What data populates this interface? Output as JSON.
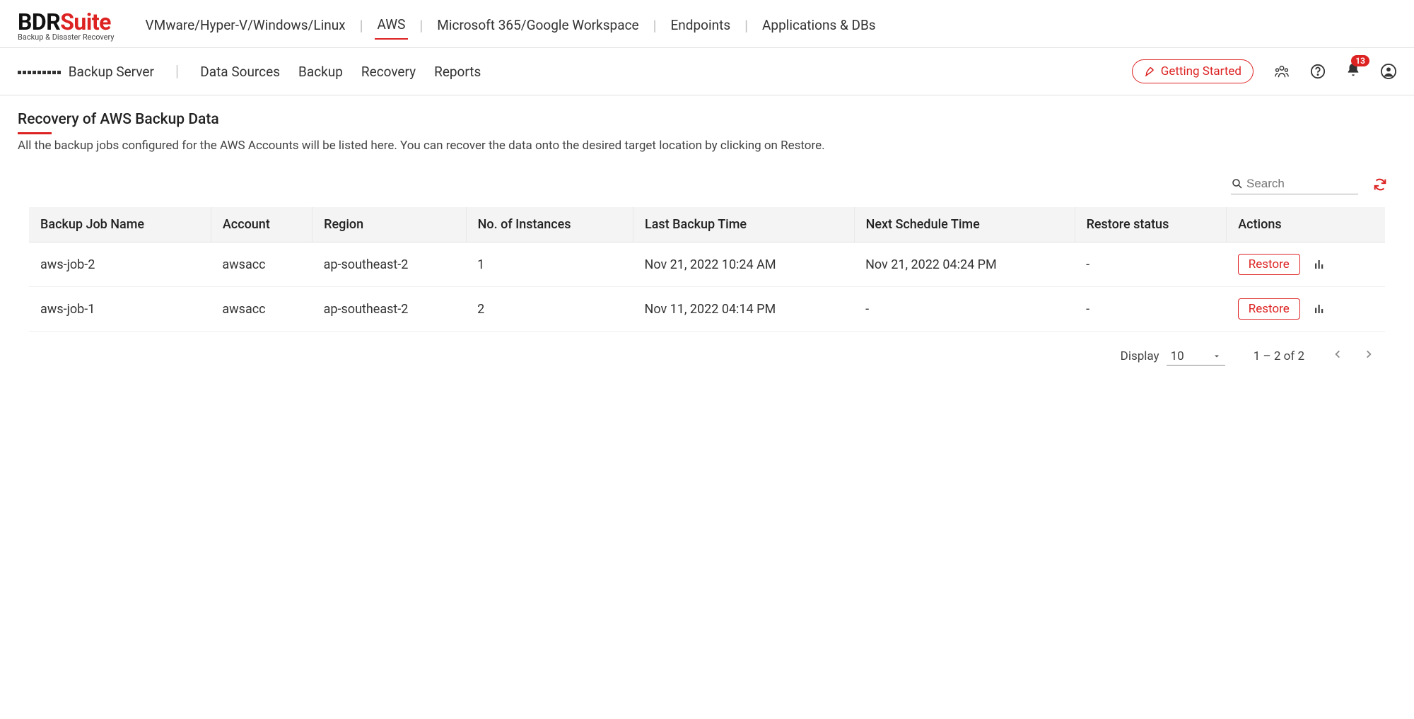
{
  "brand": {
    "main_dark": "BDR",
    "main_accent": "Suite",
    "sub": "Backup & Disaster Recovery"
  },
  "topnav": [
    {
      "label": "VMware/Hyper-V/Windows/Linux",
      "active": false
    },
    {
      "label": "AWS",
      "active": true
    },
    {
      "label": "Microsoft 365/Google Workspace",
      "active": false
    },
    {
      "label": "Endpoints",
      "active": false
    },
    {
      "label": "Applications & DBs",
      "active": false
    }
  ],
  "subnav": {
    "backup_server": "Backup Server",
    "items": [
      {
        "label": "Data Sources"
      },
      {
        "label": "Backup"
      },
      {
        "label": "Recovery"
      },
      {
        "label": "Reports"
      }
    ]
  },
  "buttons": {
    "getting_started": "Getting Started",
    "restore": "Restore"
  },
  "notifications": {
    "count": "13"
  },
  "page": {
    "title": "Recovery of AWS Backup Data",
    "description": "All the backup jobs configured for the AWS Accounts will be listed here. You can recover the data onto the desired target location by clicking on Restore."
  },
  "search": {
    "placeholder": "Search"
  },
  "table": {
    "headers": {
      "job_name": "Backup Job Name",
      "account": "Account",
      "region": "Region",
      "instances": "No. of Instances",
      "last_backup": "Last Backup Time",
      "next_schedule": "Next Schedule Time",
      "restore_status": "Restore status",
      "actions": "Actions"
    },
    "rows": [
      {
        "job_name": "aws-job-2",
        "account": "awsacc",
        "region": "ap-southeast-2",
        "instances": "1",
        "last_backup": "Nov 21, 2022 10:24 AM",
        "next_schedule": "Nov 21, 2022 04:24 PM",
        "restore_status": "-"
      },
      {
        "job_name": "aws-job-1",
        "account": "awsacc",
        "region": "ap-southeast-2",
        "instances": "2",
        "last_backup": "Nov 11, 2022 04:14 PM",
        "next_schedule": "-",
        "restore_status": "-"
      }
    ]
  },
  "pagination": {
    "display_label": "Display",
    "page_size": "10",
    "range": "1 – 2 of 2"
  }
}
